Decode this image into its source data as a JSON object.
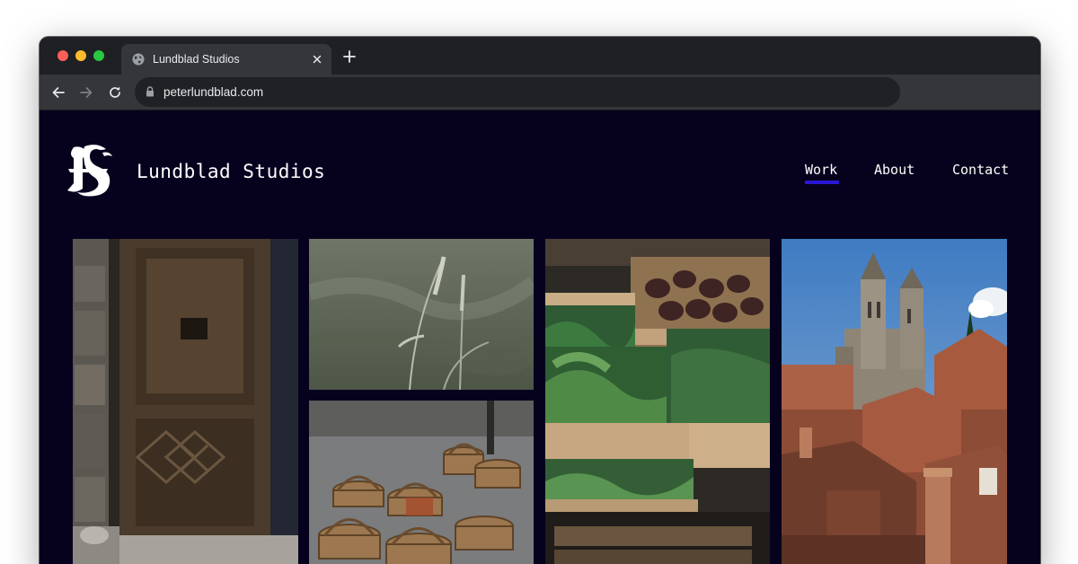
{
  "browser": {
    "tab_title": "Lundblad Studios",
    "url": "peterlundblad.com"
  },
  "site": {
    "title": "Lundblad Studios",
    "nav": {
      "work": "Work",
      "about": "About",
      "contact": "Contact",
      "active": "Work"
    }
  },
  "gallery": {
    "images": [
      {
        "subject": "weathered-wooden-door"
      },
      {
        "subject": "grass-seed-heads"
      },
      {
        "subject": "wicker-baskets"
      },
      {
        "subject": "vegetable-market-crates"
      },
      {
        "subject": "old-town-cathedral-rooftops"
      }
    ]
  },
  "colors": {
    "page_background": "#06021e",
    "nav_active_underline": "#2a17d6",
    "tab_bar": "#1f2023",
    "toolbar": "#35363a"
  }
}
